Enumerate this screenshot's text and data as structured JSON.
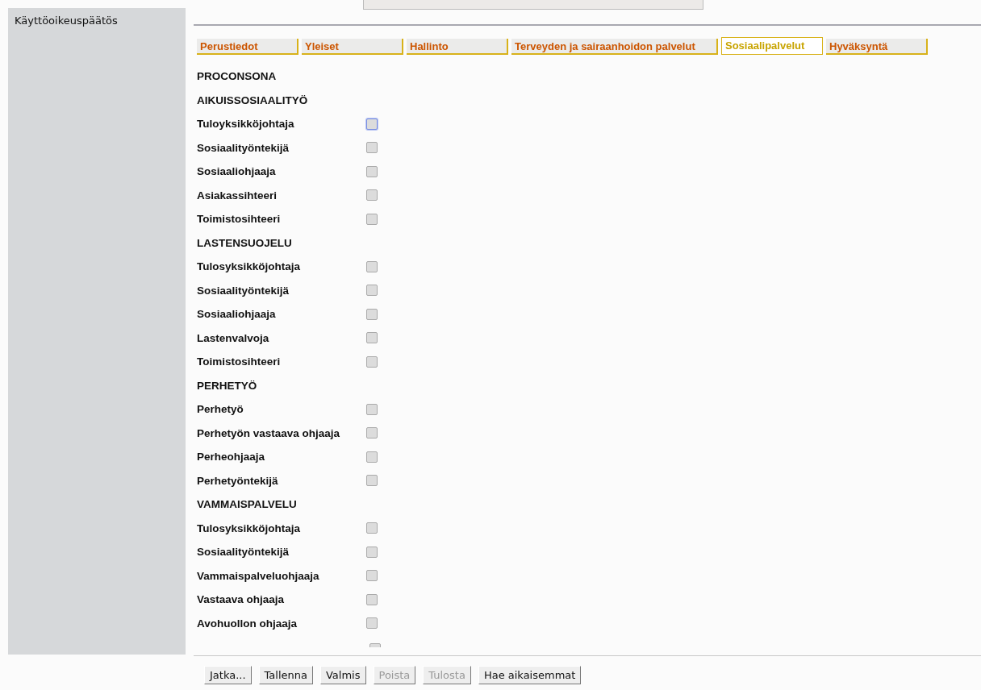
{
  "sidebar": {
    "title": "Käyttöoikeuspäätös"
  },
  "tabs": [
    {
      "label": "Perustiedot",
      "selected": false
    },
    {
      "label": "Yleiset",
      "selected": false
    },
    {
      "label": "Hallinto",
      "selected": false
    },
    {
      "label": "Terveyden ja sairaanhoidon palvelut",
      "selected": false
    },
    {
      "label": "Sosiaalipalvelut",
      "selected": true
    },
    {
      "label": "Hyväksyntä",
      "selected": false
    }
  ],
  "heading": "PROCONSONA",
  "sections": [
    {
      "title": "AIKUISSOSIAALITYÖ",
      "items": [
        {
          "label": "Tuloyksikköjohtaja",
          "checked": false,
          "focused": true
        },
        {
          "label": "Sosiaalityöntekijä",
          "checked": false,
          "focused": false
        },
        {
          "label": "Sosiaaliohjaaja",
          "checked": false,
          "focused": false
        },
        {
          "label": "Asiakassihteeri",
          "checked": false,
          "focused": false
        },
        {
          "label": "Toimistosihteeri",
          "checked": false,
          "focused": false
        }
      ]
    },
    {
      "title": "LASTENSUOJELU",
      "items": [
        {
          "label": "Tulosyksikköjohtaja",
          "checked": false,
          "focused": false
        },
        {
          "label": "Sosiaalityöntekijä",
          "checked": false,
          "focused": false
        },
        {
          "label": "Sosiaaliohjaaja",
          "checked": false,
          "focused": false
        },
        {
          "label": "Lastenvalvoja",
          "checked": false,
          "focused": false
        },
        {
          "label": "Toimistosihteeri",
          "checked": false,
          "focused": false
        }
      ]
    },
    {
      "title": "PERHETYÖ",
      "items": [
        {
          "label": "Perhetyö",
          "checked": false,
          "focused": false
        },
        {
          "label": "Perhetyön vastaava ohjaaja",
          "checked": false,
          "focused": false
        },
        {
          "label": "Perheohjaaja",
          "checked": false,
          "focused": false
        },
        {
          "label": "Perhetyöntekijä",
          "checked": false,
          "focused": false
        }
      ]
    },
    {
      "title": "VAMMAISPALVELU",
      "items": [
        {
          "label": "Tulosyksikköjohtaja",
          "checked": false,
          "focused": false
        },
        {
          "label": "Sosiaalityöntekijä",
          "checked": false,
          "focused": false
        },
        {
          "label": "Vammaispalveluohjaaja",
          "checked": false,
          "focused": false
        },
        {
          "label": "Vastaava ohjaaja",
          "checked": false,
          "focused": false
        },
        {
          "label": "Avohuollon ohjaaja",
          "checked": false,
          "focused": false
        }
      ]
    }
  ],
  "cut_off_row": {
    "checked": false
  },
  "buttons": [
    {
      "label": "Jatka...",
      "disabled": false
    },
    {
      "label": "Tallenna",
      "disabled": false
    },
    {
      "label": "Valmis",
      "disabled": false
    },
    {
      "label": "Poista",
      "disabled": true
    },
    {
      "label": "Tulosta",
      "disabled": true
    },
    {
      "label": "Hae aikaisemmat",
      "disabled": false
    }
  ]
}
